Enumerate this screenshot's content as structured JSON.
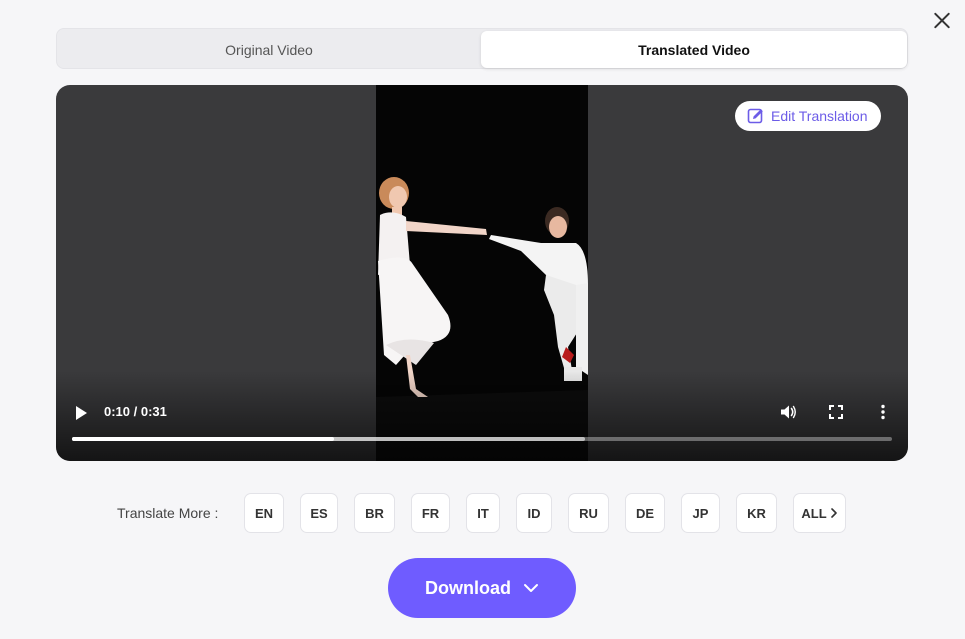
{
  "dialog": {
    "close_icon": "close-icon"
  },
  "tabs": [
    {
      "label": "Original Video",
      "active": false
    },
    {
      "label": "Translated Video",
      "active": true
    }
  ],
  "video": {
    "edit_translation_label": "Edit Translation",
    "edit_icon": "edit-icon",
    "time_display": "0:10 / 0:31",
    "progress": 0.32,
    "buffered": 0.625,
    "icons": [
      "play-icon",
      "volume-icon",
      "fullscreen-icon",
      "more-options-icon"
    ]
  },
  "translate_more": {
    "label": "Translate More :",
    "languages": [
      "EN",
      "ES",
      "BR",
      "FR",
      "IT",
      "ID",
      "RU",
      "DE",
      "JP",
      "KR"
    ],
    "all_label": "ALL",
    "all_icon": "chevron-right-icon"
  },
  "download": {
    "label": "Download",
    "icon": "chevron-down-icon"
  },
  "colors": {
    "accent": "#6f5cff",
    "accent_text": "#6c5ce7",
    "background": "#f6f6f8",
    "video_bg": "#3a3a3c"
  }
}
